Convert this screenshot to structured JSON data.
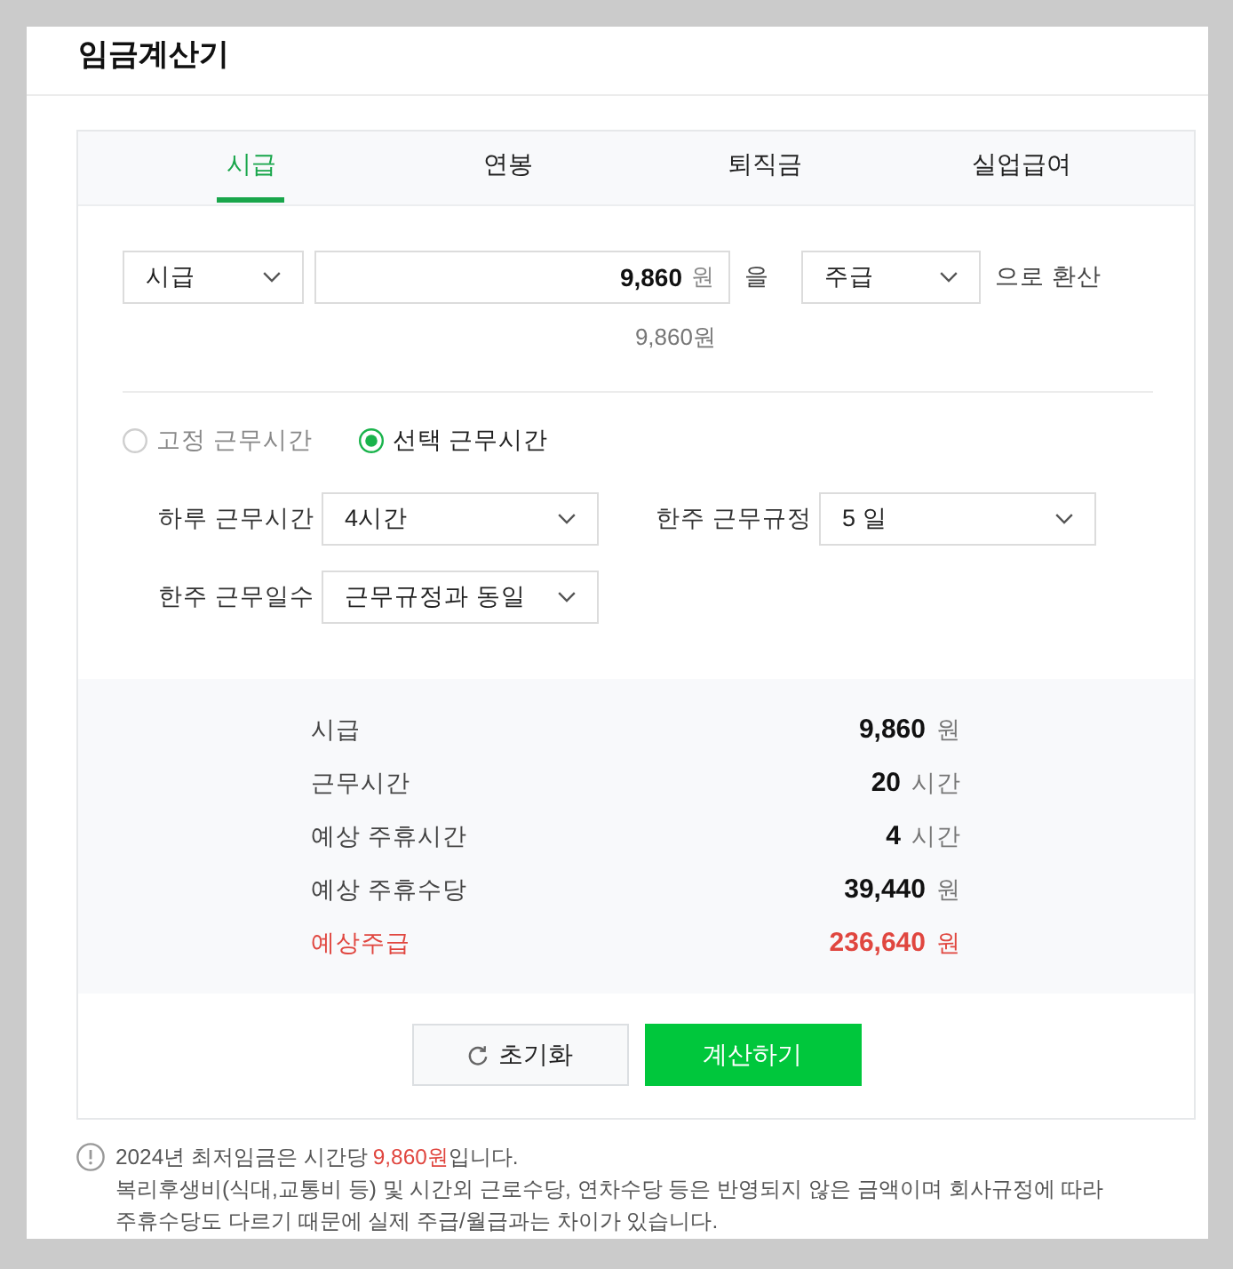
{
  "title": "임금계산기",
  "tabs": [
    {
      "label": "시급",
      "selected": true
    },
    {
      "label": "연봉",
      "selected": false
    },
    {
      "label": "퇴직금",
      "selected": false
    },
    {
      "label": "실업급여",
      "selected": false
    }
  ],
  "converter": {
    "from_unit": "시급",
    "amount": "9,860",
    "amount_unit": "원",
    "particle": "을",
    "to_unit": "주급",
    "suffix": "으로 환산",
    "converted": "9,860원"
  },
  "work_hours_type": [
    {
      "label": "고정 근무시간",
      "selected": false
    },
    {
      "label": "선택 근무시간",
      "selected": true
    }
  ],
  "settings": [
    {
      "label": "하루 근무시간",
      "value": "4시간"
    },
    {
      "label": "한주 근무규정",
      "value": "5 일"
    },
    {
      "label": "한주 근무일수",
      "value": "근무규정과 동일"
    }
  ],
  "results": [
    {
      "kind": "item",
      "label": "시급",
      "value": "9,860",
      "unit": "원"
    },
    {
      "kind": "item",
      "label": "근무시간",
      "value": "20",
      "unit": "시간"
    },
    {
      "kind": "item",
      "label": "예상 주휴시간",
      "value": "4",
      "unit": "시간"
    },
    {
      "kind": "item",
      "label": "예상 주휴수당",
      "value": "39,440",
      "unit": "원"
    },
    {
      "kind": "total",
      "label": "예상주급",
      "value": "236,640",
      "unit": "원"
    }
  ],
  "buttons": [
    {
      "kind": "reset",
      "label": "초기화"
    },
    {
      "kind": "primary",
      "label": "계산하기"
    }
  ],
  "notice": {
    "before": "2024년 최저임금은 시간당",
    "amount": "9,860원",
    "after": "입니다.",
    "detail": "복리후생비(식대,교통비 등) 및 시간외 근로수당, 연차수당 등은 반영되지 않은 금액이며 회사규정에 따라 주휴수당도 다르기 때문에 실제 주급/월급과는 차이가 있습니다."
  }
}
